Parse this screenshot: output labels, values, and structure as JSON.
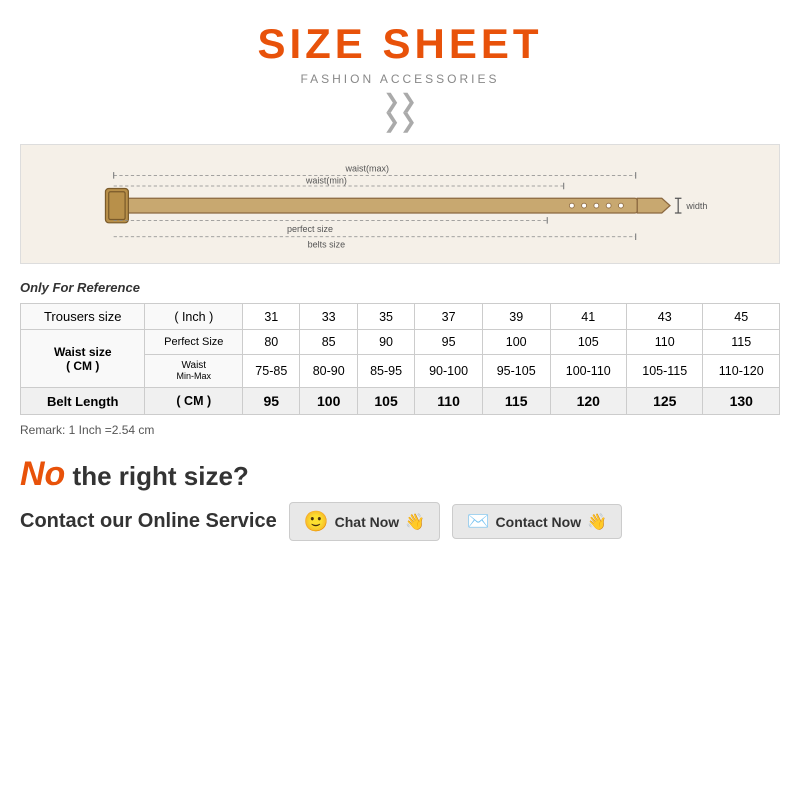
{
  "title": "SIZE SHEET",
  "subtitle": "FASHION ACCESSORIES",
  "reference_label": "Only For Reference",
  "table": {
    "columns": [
      "Trousers size",
      "( Inch )",
      "31",
      "33",
      "35",
      "37",
      "39",
      "41",
      "43",
      "45"
    ],
    "waist_label": "Waist size\n( CM )",
    "perfect_size_label": "Perfect Size",
    "waist_min_max_label": "Waist Min-Max",
    "perfect_sizes": [
      "80",
      "85",
      "90",
      "95",
      "100",
      "105",
      "110",
      "115"
    ],
    "waist_ranges": [
      "75-85",
      "80-90",
      "85-95",
      "90-100",
      "95-105",
      "100-110",
      "105-115",
      "110-120"
    ],
    "belt_length_label": "Belt Length",
    "belt_length_unit": "( CM )",
    "belt_lengths": [
      "95",
      "100",
      "105",
      "110",
      "115",
      "120",
      "125",
      "130"
    ]
  },
  "remark": "Remark: 1 Inch =2.54 cm",
  "no_size_text": "No",
  "no_size_question": " the right size?",
  "contact_label": "Contact our Online Service",
  "chat_btn_label": "Chat Now",
  "contact_btn_label": "Contact Now",
  "belt_diagram": {
    "waist_max": "waist(max)",
    "waist_min": "waist(min)",
    "perfect_size": "perfect size",
    "belts_size": "belts size",
    "width": "width"
  }
}
